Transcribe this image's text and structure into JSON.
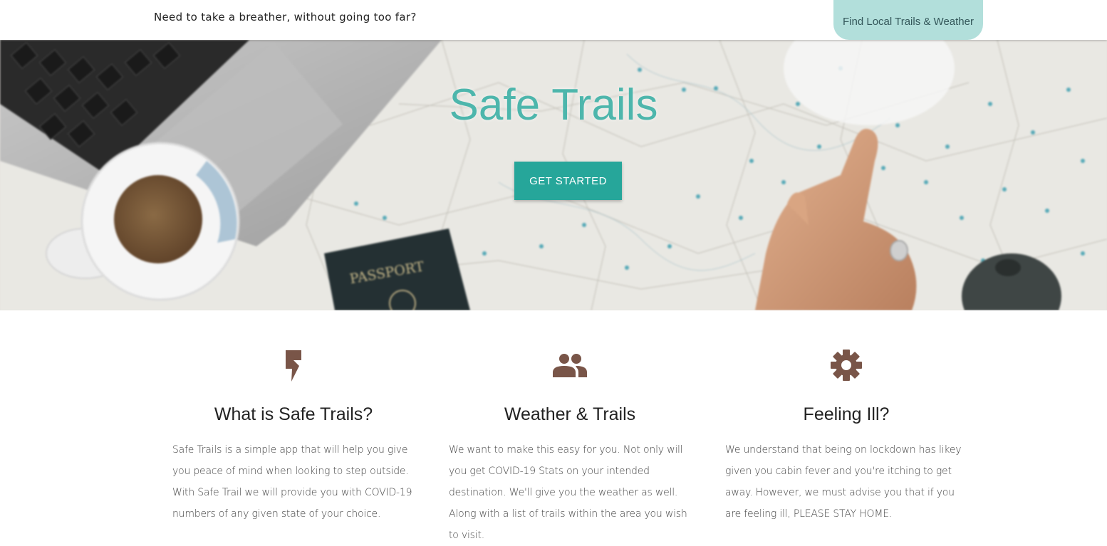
{
  "header": {
    "tagline": "Need to take a breather, without going too far?",
    "nav_button": "Find Local Trails & Weather"
  },
  "hero": {
    "title": "Safe Trails",
    "cta_label": "GET STARTED",
    "passport_text": "PASSPORT"
  },
  "features": [
    {
      "icon": "bolt-icon",
      "title": "What is Safe Trails?",
      "text": "Safe Trails is a simple app that will help you give you peace of mind when looking to step outside. With Safe Trail we will provide you with COVID-19 numbers of any given state of your choice."
    },
    {
      "icon": "group-icon",
      "title": "Weather & Trails",
      "text": "We want to make this easy for you. Not only will you get COVID-19 Stats on your intended destination. We'll give you the weather as well. Along with a list of trails within the area you wish to visit."
    },
    {
      "icon": "gear-icon",
      "title": "Feeling Ill?",
      "text": "We understand that being on lockdown has likey given you cabin fever and you're itching to get away. However, we must advise you that if you are feeling ill, PLEASE STAY HOME."
    }
  ],
  "colors": {
    "accent": "#26a69a",
    "title_teal": "#4db6ac",
    "nav_button_bg": "#b2dfdb",
    "icon_brown": "#795548"
  }
}
